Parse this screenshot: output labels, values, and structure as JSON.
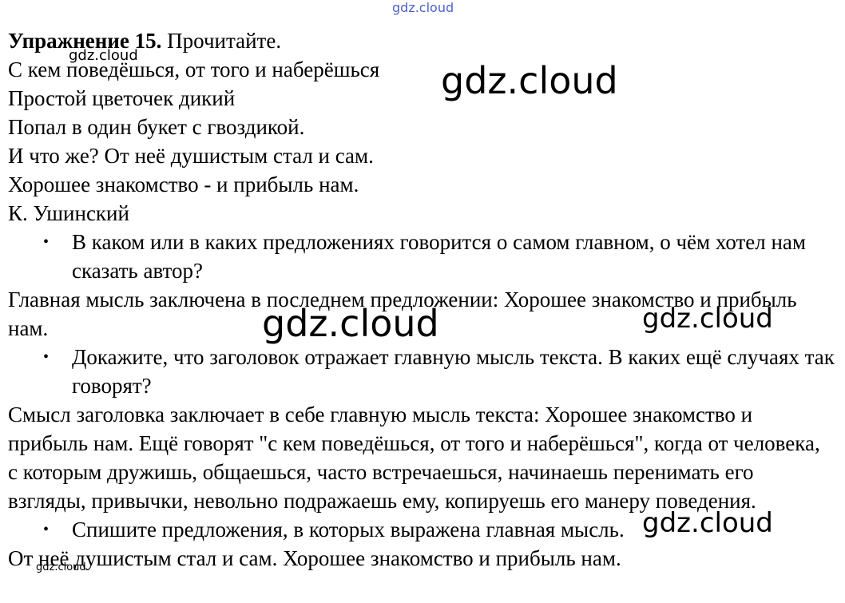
{
  "watermarks": {
    "top": "gdz.cloud",
    "small_top_left": "gdz.cloud",
    "large_1": "gdz.cloud",
    "large_2": "gdz.cloud",
    "medium_1": "gdz.cloud",
    "medium_2": "gdz.cloud",
    "tiny_bottom": "gdz.cloud"
  },
  "exercise": {
    "title_bold": "Упражнение 15.",
    "title_rest": " Прочитайте.",
    "poem": [
      "С кем поведёшься, от того и наберёшься",
      "Простой цветочек дикий",
      "Попал в один букет с гвоздикой.",
      "И что же? От неё душистым стал и сам.",
      "Хорошее знакомство - и прибыль нам.",
      "К. Ушинский"
    ],
    "q1": {
      "bullet": "•",
      "text": "В каком или в каких предложениях говорится о самом главном, о чём хотел нам сказать автор?"
    },
    "a1": "Главная мысль заключена в последнем предложении: Хорошее знакомство и прибыль нам.",
    "q2": {
      "bullet": "•",
      "text": "Докажите, что заголовок отражает главную мысль текста. В каких ещё случаях так говорят?"
    },
    "a2": "Смысл заголовка заключает в себе главную мысль текста: Хорошее знакомство и прибыль нам. Ещё говорят \"с кем поведёшься, от того и наберёшься\", когда от человека, с которым дружишь, общаешься, часто встречаешься, начинаешь перенимать его взгляды, привычки, невольно подражаешь ему, копируешь его манеру поведения.",
    "q3": {
      "bullet": "•",
      "text": "Спишите предложения, в которых выражена главная мысль."
    },
    "a3": "От неё душистым стал и сам. Хорошее знакомство и прибыль нам."
  }
}
